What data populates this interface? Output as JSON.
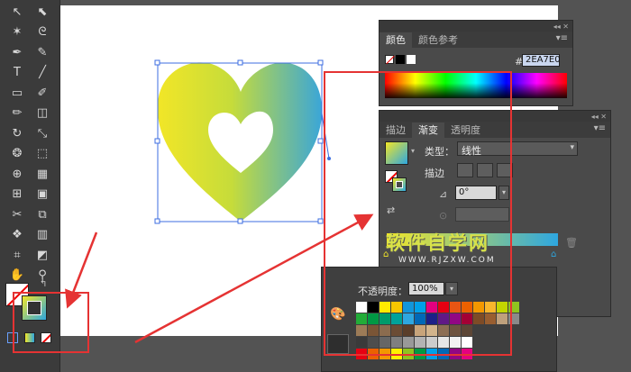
{
  "toolbar": {
    "tools": [
      "select-tool",
      "direct-select-tool",
      "magic-wand-tool",
      "lasso-tool",
      "pen-tool",
      "curvature-tool",
      "type-tool",
      "line-tool",
      "rectangle-tool",
      "paintbrush-tool",
      "pencil-tool",
      "eraser-tool",
      "rotate-tool",
      "scale-tool",
      "warp-tool",
      "free-transform-tool",
      "shape-builder-tool",
      "perspective-grid-tool",
      "mesh-tool",
      "gradient-tool",
      "eyedropper-tool",
      "blend-tool",
      "symbol-sprayer-tool",
      "column-graph-tool",
      "artboard-tool",
      "slice-tool",
      "hand-tool",
      "zoom-tool"
    ],
    "type_tool_glyph": "T"
  },
  "color_panel": {
    "tabs": [
      "颜色",
      "颜色参考"
    ],
    "hex_prefix": "#",
    "hex_value": "2EA7E0"
  },
  "gradient_panel": {
    "tabs": [
      "描边",
      "渐变",
      "透明度"
    ],
    "type_label": "类型：",
    "type_value": "线性",
    "stroke_label": "描边",
    "angle_value": "0°"
  },
  "swatch_panel": {
    "opacity_label": "不透明度：",
    "opacity_value": "100%"
  },
  "watermark": {
    "main": "软件自学网",
    "sub": "WWW.RJZXW.COM"
  },
  "colors": {
    "annotation_red": "#e53333",
    "gradient_start": "#f2e627",
    "gradient_end": "#2ea7e0"
  },
  "swatches": {
    "row1": [
      "#ffffff",
      "#000000",
      "#ffea00",
      "#f7c600",
      "#1296db",
      "#00a0e9",
      "#e4007f",
      "#e60012",
      "#e95513",
      "#eb6100",
      "#f39800",
      "#f8b62d",
      "#c2d500",
      "#8fc31f"
    ],
    "row2": [
      "#22ac38",
      "#009944",
      "#009b6b",
      "#00a29a",
      "#2ea7e0",
      "#0068b7",
      "#1d2088",
      "#601986",
      "#920783",
      "#a40035",
      "#7e4b26",
      "#995e30",
      "#bfa07c",
      "#8a8a8a"
    ],
    "row3": [
      "#9c7b57",
      "#7a5536",
      "#8b6c4f",
      "#6b4c35",
      "#5a3e2a",
      "#c8a47a",
      "#d2b48c",
      "#8c6e54",
      "#6e5440",
      "#5c4636"
    ],
    "row4": [
      "#3a3a3a",
      "#4d4d4d",
      "#666666",
      "#7f7f7f",
      "#999999",
      "#b3b3b3",
      "#cccccc",
      "#e6e6e6",
      "#f2f2f2",
      "#ffffff"
    ],
    "row5": [
      "#e60012",
      "#eb6100",
      "#f39800",
      "#fff100",
      "#8fc31f",
      "#009944",
      "#00a0e9",
      "#0068b7",
      "#920783",
      "#e4007f"
    ]
  }
}
